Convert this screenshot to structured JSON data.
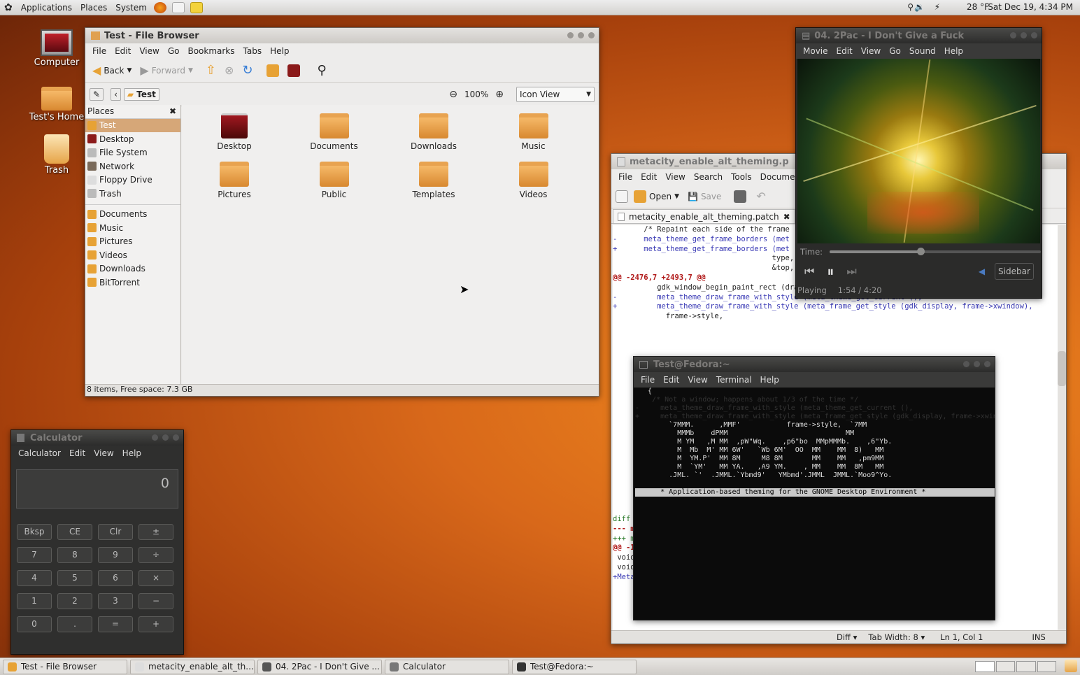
{
  "top_panel": {
    "menus": [
      "Applications",
      "Places",
      "System"
    ],
    "weather": "28 °F",
    "clock": "Sat Dec 19,  4:34 PM"
  },
  "desktop": {
    "icons": [
      "Computer",
      "Test's Home",
      "Trash"
    ]
  },
  "file_browser": {
    "title": "Test - File Browser",
    "menus": [
      "File",
      "Edit",
      "View",
      "Go",
      "Bookmarks",
      "Tabs",
      "Help"
    ],
    "back": "Back",
    "forward": "Forward",
    "location": "Test",
    "zoom": "100%",
    "view_mode": "Icon View",
    "places_label": "Places",
    "places": [
      "Test",
      "Desktop",
      "File System",
      "Network",
      "Floppy Drive",
      "Trash"
    ],
    "bookmarks": [
      "Documents",
      "Music",
      "Pictures",
      "Videos",
      "Downloads",
      "BitTorrent"
    ],
    "items": [
      "Desktop",
      "Documents",
      "Downloads",
      "Music",
      "Pictures",
      "Public",
      "Templates",
      "Videos"
    ],
    "status": "8 items, Free space: 7.3 GB"
  },
  "editor": {
    "title": "metacity_enable_alt_theming.p",
    "menus": [
      "File",
      "Edit",
      "View",
      "Search",
      "Tools",
      "Documents"
    ],
    "open": "Open",
    "save": "Save",
    "tab": "metacity_enable_alt_theming.patch",
    "lines": [
      {
        "t": "       /* Repaint each side of the frame",
        "c": "cm"
      },
      {
        "t": "",
        "c": "cm"
      },
      {
        "t": "-      meta_theme_get_frame_borders (met",
        "c": "cp"
      },
      {
        "t": "+      meta_theme_get_frame_borders (met",
        "c": "cp"
      },
      {
        "t": "                                    type, fram",
        "c": "cm"
      },
      {
        "t": "                                    &top, &bot",
        "c": "cm"
      },
      {
        "t": "",
        "c": "cm"
      },
      {
        "t": "@@ -2476,7 +2493,7 @@",
        "c": "cr"
      },
      {
        "t": "",
        "c": "cm"
      },
      {
        "t": "          gdk_window_begin_paint_rect (drawable, &areas[i]);",
        "c": "cm"
      },
      {
        "t": "",
        "c": "cm"
      },
      {
        "t": "-         meta_theme_draw_frame_with_style (meta_theme_get_current (),",
        "c": "cp"
      },
      {
        "t": "+         meta_theme_draw_frame_with_style (meta_frame_get_style (gdk_display, frame->xwindow),",
        "c": "cp"
      },
      {
        "t": "            frame->style,",
        "c": "cm"
      }
    ],
    "tail_lines": [
      {
        "t": "diff -ruN metacity-2.28.0/src/ui/frames.h metacity-2.28.0-patched/src/ui/frames.h",
        "c": "cg"
      },
      {
        "t": "--- metacity-2.28.0/src/ui/frames.h      2009-09-08 16:55:15.000000000 -0400",
        "c": "cr"
      },
      {
        "t": "+++ metacity-2.28.0-patched/src/ui/frames.h      2009-12-16 00:08:36.189160000 -0500",
        "c": "cg"
      },
      {
        "t": "@@ -150,4 +150,6 @@",
        "c": "cr"
      },
      {
        "t": " void meta_frames_push_delay_exposes (MetaFrames *frames);",
        "c": "cm"
      },
      {
        "t": " void meta_frames_pop_delay_exposes  (MetaFrames *frames);",
        "c": "cm"
      },
      {
        "t": "",
        "c": "cm"
      },
      {
        "t": "+MetaTheme* meta_frame_get_style (Display *xdisplay,",
        "c": "cp"
      }
    ],
    "status": {
      "lang": "Diff",
      "tab_width": "Tab Width:  8",
      "position": "Ln 1, Col 1",
      "mode": "INS"
    }
  },
  "player": {
    "title": "04. 2Pac - I Don't Give a Fuck",
    "menus": [
      "Movie",
      "Edit",
      "View",
      "Go",
      "Sound",
      "Help"
    ],
    "time_label": "Time:",
    "progress": 0.43,
    "sidebar": "Sidebar",
    "state": "Playing",
    "time": "1:54 / 4:20"
  },
  "terminal": {
    "title": "Test@Fedora:~",
    "menus": [
      "File",
      "Edit",
      "View",
      "Terminal",
      "Help"
    ],
    "art": [
      "",
      "   {",
      "    /* Not a window; happens about 1/3 of the time */",
      "",
      "-     meta_theme_draw_frame_with_style (meta_theme_get_current (),",
      "+     meta_theme_draw_frame_with_style (meta_frame_get_style (gdk_display, frame->xwindow),",
      "        `7MMM.      ,MMF'           frame->style,  `7MM",
      "          MMMb    dPMM                            MM",
      "          M YM   ,M MM  ,pW\"Wq.    ,p6\"bo  MMpMMMb.    ,6\"Yb.",
      "          M  Mb  M' MM 6W'   `Wb 6M'  OO  MM    MM  8)   MM",
      "          M  YM.P'  MM 8M     M8 8M       MM    MM   ,pm9MM",
      "          M  `YM'   MM YA.   ,A9 YM.    , MM    MM  8M   MM",
      "        .JML. `'  .JMML.`Ybmd9'   YMbmd'.JMML  JMML.`Moo9^Yo."
    ],
    "banner": "      * Application-based theming for the GNOME Desktop Environment *"
  },
  "calculator": {
    "title": "Calculator",
    "menus": [
      "Calculator",
      "Edit",
      "View",
      "Help"
    ],
    "display": "0",
    "buttons": [
      [
        "Bksp",
        "CE",
        "Clr",
        "±"
      ],
      [
        "7",
        "8",
        "9",
        "÷"
      ],
      [
        "4",
        "5",
        "6",
        "×"
      ],
      [
        "1",
        "2",
        "3",
        "−"
      ],
      [
        "0",
        ".",
        "=",
        "+"
      ]
    ]
  },
  "taskbar": {
    "tasks": [
      "Test - File Browser",
      "metacity_enable_alt_th...",
      "04. 2Pac - I Don't Give ...",
      "Calculator",
      "Test@Fedora:~"
    ]
  }
}
